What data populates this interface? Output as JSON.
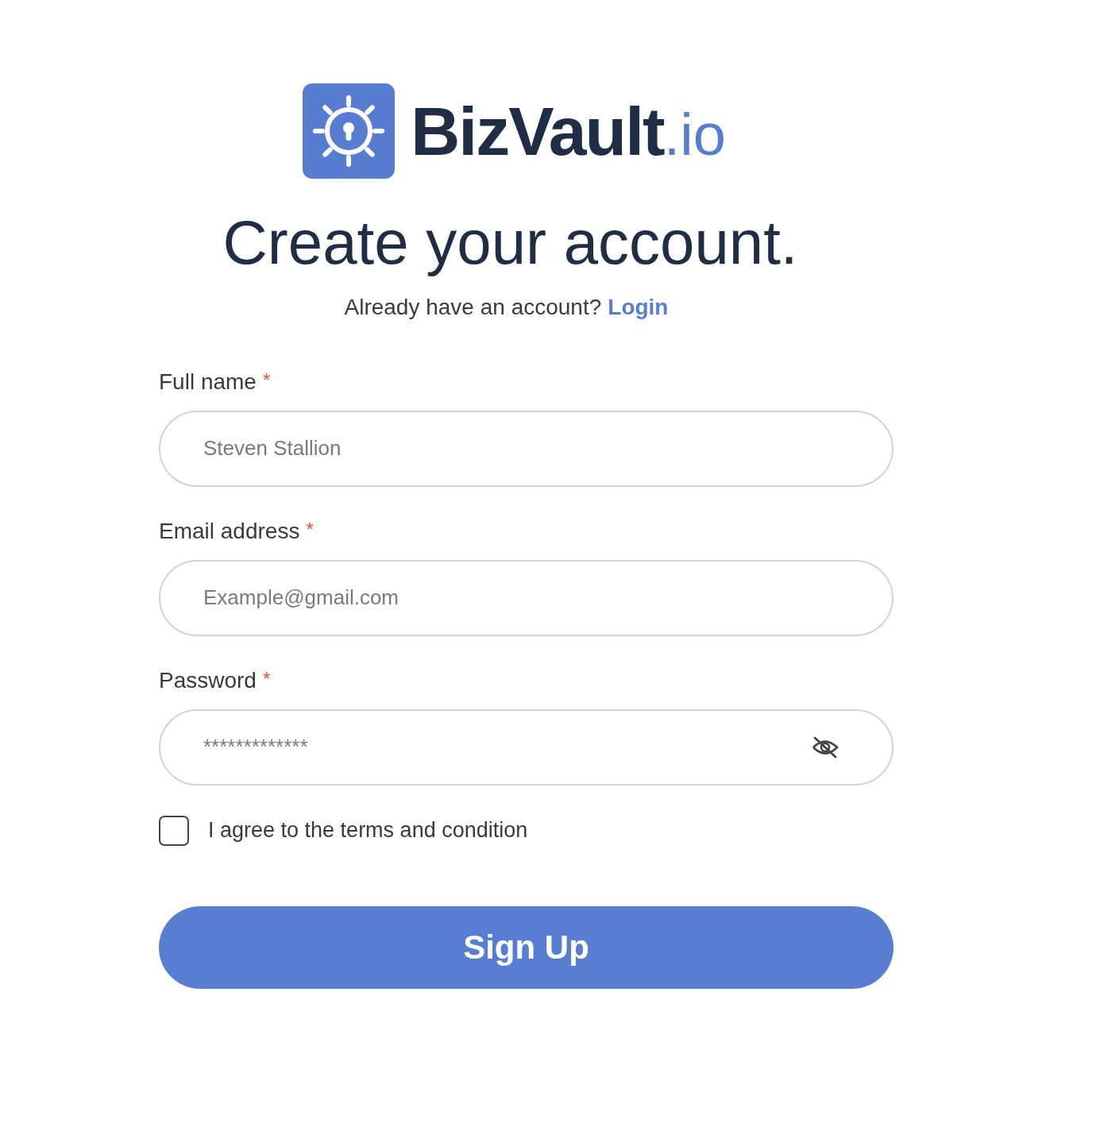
{
  "brand": {
    "name": "BizVault",
    "suffix": ".io"
  },
  "heading": "Create your account.",
  "subtitle": {
    "text": "Already have an account?",
    "link": "Login"
  },
  "fields": [
    {
      "kind": "text",
      "label": "Full name",
      "required": true,
      "required_mark": "*",
      "placeholder": "Steven Stallion"
    },
    {
      "kind": "email",
      "label": "Email address",
      "required": true,
      "required_mark": "*",
      "placeholder": "Example@gmail.com"
    },
    {
      "kind": "password",
      "label": "Password",
      "required": true,
      "required_mark": "*",
      "value": "*************"
    }
  ],
  "terms": {
    "label": "I agree to the terms and condition",
    "checked": false
  },
  "submit": "Sign Up"
}
